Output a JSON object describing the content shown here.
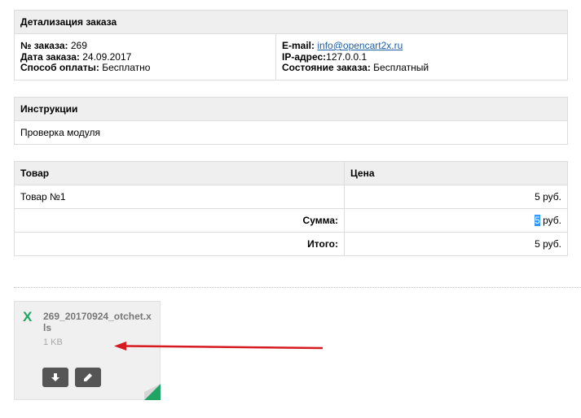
{
  "order": {
    "title": "Детализация заказа",
    "order_no_label": "№ заказа:",
    "order_no": "269",
    "date_label": "Дата заказа:",
    "date": "24.09.2017",
    "payment_label": "Способ оплаты:",
    "payment": "Бесплатно",
    "email_label": "E-mail:",
    "email": "info@opencart2x.ru",
    "ip_label": "IP-адрес:",
    "ip": "127.0.0.1",
    "status_label": "Состояние заказа:",
    "status": "Бесплатный"
  },
  "instructions": {
    "title": "Инструкции",
    "text": "Проверка модуля"
  },
  "products": {
    "col_product": "Товар",
    "col_price": "Цена",
    "rows": [
      {
        "name": "Товар №1",
        "price": "5 руб."
      }
    ],
    "subtotal_label": "Сумма:",
    "subtotal_value": "5",
    "subtotal_unit": " руб.",
    "total_label": "Итого:",
    "total_value": "5 руб."
  },
  "attachment": {
    "file_name": "269_20170924_otchet.xls",
    "file_size": "1 KB",
    "icon": "excel-icon"
  },
  "colors": {
    "excel_green": "#1fa463",
    "arrow_red": "#d71920",
    "button_dark": "#555555",
    "link_blue": "#1e5fa8"
  }
}
